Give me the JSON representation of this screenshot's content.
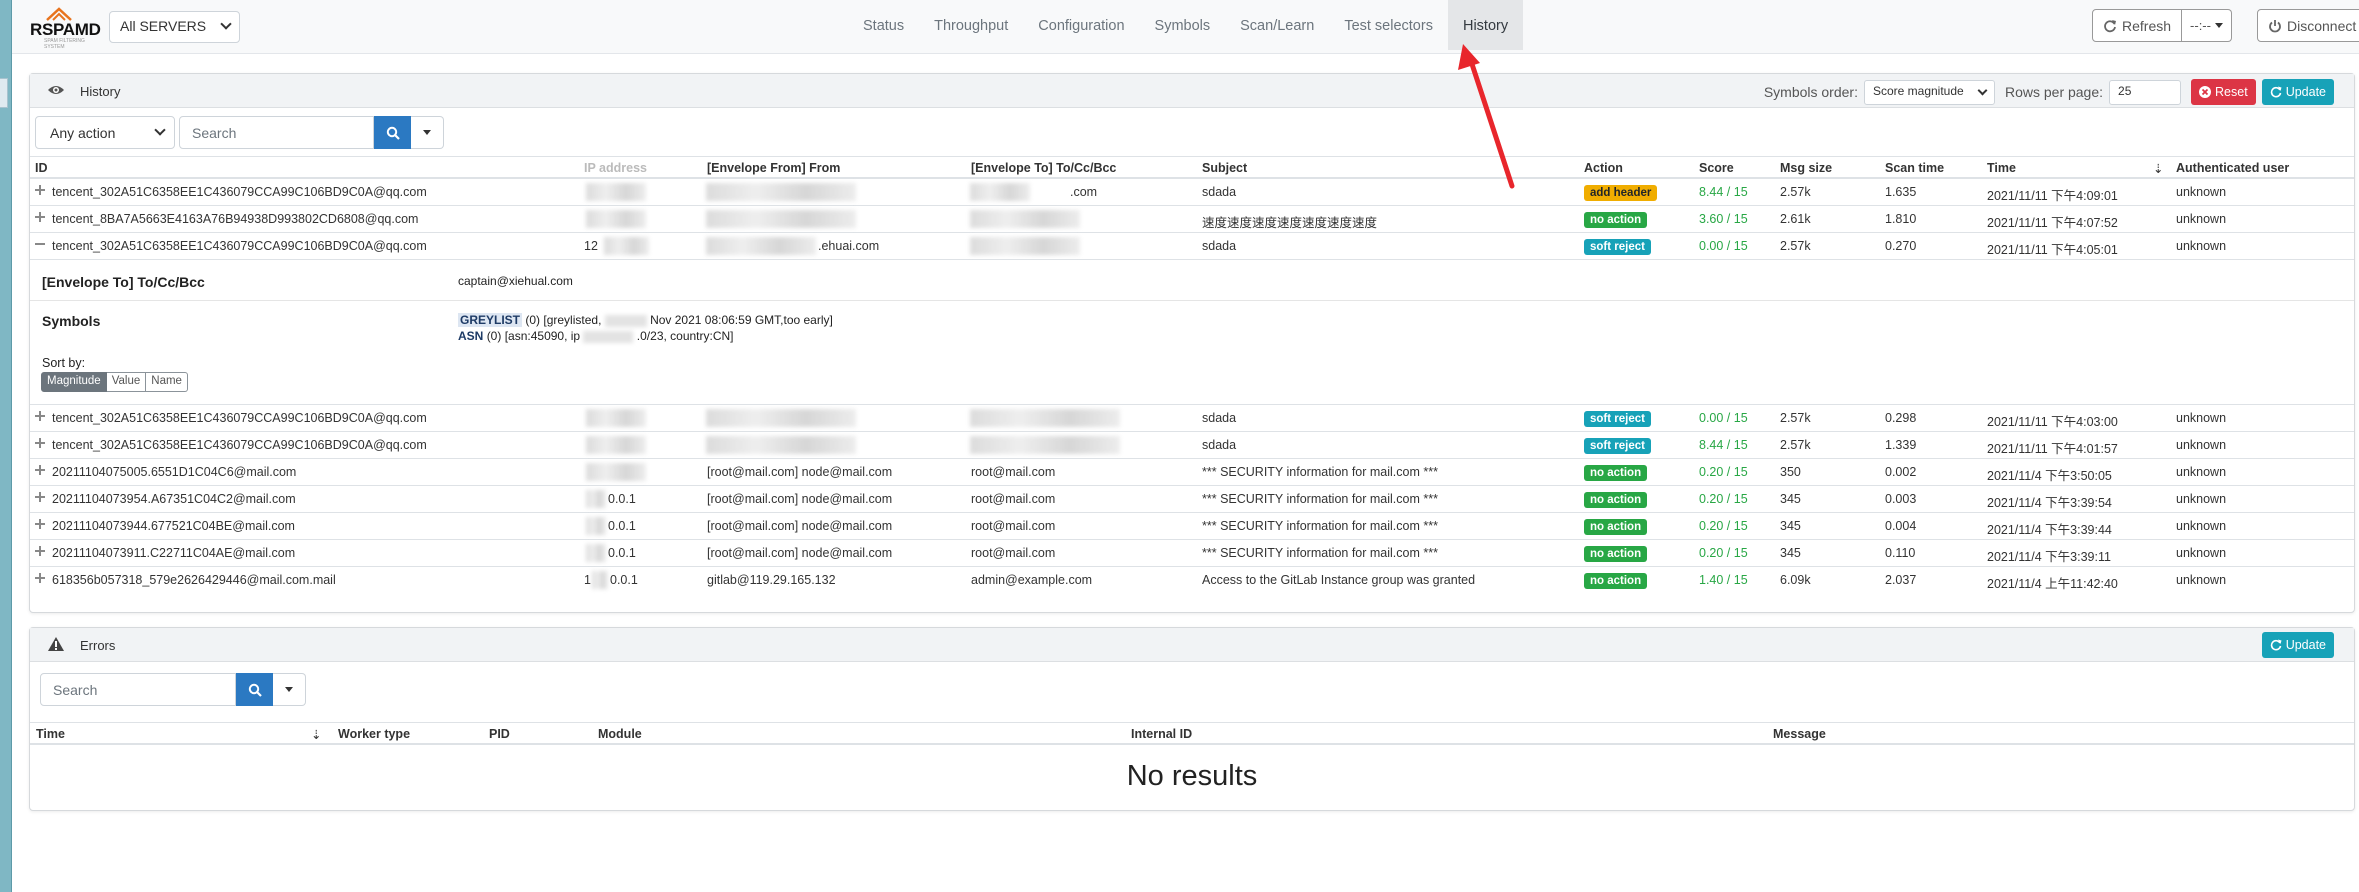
{
  "brand": {
    "logo_text": "RSPAMD",
    "logo_sub": "SPAM FILTERING SYSTEM"
  },
  "server_select": {
    "value": "All SERVERS"
  },
  "nav": {
    "items": [
      "Status",
      "Throughput",
      "Configuration",
      "Symbols",
      "Scan/Learn",
      "Test selectors",
      "History"
    ],
    "active": "History"
  },
  "header_buttons": {
    "refresh": "Refresh",
    "interval": "--:--",
    "disconnect": "Disconnect"
  },
  "history": {
    "title": "History",
    "symbols_order_label": "Symbols order:",
    "symbols_order_value": "Score magnitude",
    "rows_per_page_label": "Rows per page:",
    "rows_per_page": "25",
    "reset_label": "Reset",
    "update_label": "Update",
    "action_filter": "Any action",
    "search_placeholder": "Search",
    "columns": {
      "id": "ID",
      "ip": "IP address",
      "from": "[Envelope From] From",
      "to": "[Envelope To] To/Cc/Bcc",
      "subject": "Subject",
      "action": "Action",
      "score": "Score",
      "size": "Msg size",
      "scan_time": "Scan time",
      "time": "Time",
      "user": "Authenticated user"
    },
    "rows_top": [
      {
        "id": "tencent_302A51C6358EE1C436079CCA99C106BD9C0A@qq.com",
        "ip": "",
        "from": "",
        "to": ".com",
        "subject": "sdada",
        "action": "add header",
        "score": "8.44 / 15",
        "size": "2.57k",
        "scan_time": "1.635",
        "time": "2021/11/11 下午4:09:01",
        "user": "unknown"
      },
      {
        "id": "tencent_8BA7A5663E4163A76B94938D993802CD6808@qq.com",
        "ip": "",
        "from": "",
        "to": "",
        "subject": "速度速度速度速度速度速度速度",
        "action": "no action",
        "score": "3.60 / 15",
        "size": "2.61k",
        "scan_time": "1.810",
        "time": "2021/11/11 下午4:07:52",
        "user": "unknown"
      },
      {
        "id": "tencent_302A51C6358EE1C436079CCA99C106BD9C0A@qq.com",
        "ip": "12",
        "from": ".ehuai.com",
        "to": "",
        "subject": "sdada",
        "action": "soft reject",
        "score": "0.00 / 15",
        "size": "2.57k",
        "scan_time": "0.270",
        "time": "2021/11/11 下午4:05:01",
        "user": "unknown"
      }
    ],
    "detail": {
      "to_label": "[Envelope To] To/Cc/Bcc",
      "to_value": "captain@xiehual.com",
      "symbols_label": "Symbols",
      "sym1_name": "GREYLIST",
      "sym1_score": "(0)",
      "sym1_args": "[greylisted, ",
      "sym1_rest": "Nov 2021 08:06:59 GMT,too early]",
      "sym2_name": "ASN",
      "sym2_score": "(0)",
      "sym2_args": "[asn:45090, ip",
      "sym2_rest": ".0/23, country:CN]",
      "sort_label": "Sort by:",
      "sort_options": [
        "Magnitude",
        "Value",
        "Name"
      ]
    },
    "rows_bottom": [
      {
        "id": "tencent_302A51C6358EE1C436079CCA99C106BD9C0A@qq.com",
        "ip": "",
        "from": "",
        "to": "",
        "subject": "sdada",
        "action": "soft reject",
        "score": "0.00 / 15",
        "size": "2.57k",
        "scan_time": "0.298",
        "time": "2021/11/11 下午4:03:00",
        "user": "unknown"
      },
      {
        "id": "tencent_302A51C6358EE1C436079CCA99C106BD9C0A@qq.com",
        "ip": "",
        "from": "",
        "to": "",
        "subject": "sdada",
        "action": "soft reject",
        "score": "8.44 / 15",
        "size": "2.57k",
        "scan_time": "1.339",
        "time": "2021/11/11 下午4:01:57",
        "user": "unknown"
      },
      {
        "id": "20211104075005.6551D1C04C6@mail.com",
        "ip": "",
        "from": "[root@mail.com] node@mail.com",
        "to": "root@mail.com",
        "subject": "*** SECURITY information for mail.com ***",
        "action": "no action",
        "score": "0.20 / 15",
        "size": "350",
        "scan_time": "0.002",
        "time": "2021/11/4 下午3:50:05",
        "user": "unknown"
      },
      {
        "id": "20211104073954.A67351C04C2@mail.com",
        "ip": "0.0.1",
        "from": "[root@mail.com] node@mail.com",
        "to": "root@mail.com",
        "subject": "*** SECURITY information for mail.com ***",
        "action": "no action",
        "score": "0.20 / 15",
        "size": "345",
        "scan_time": "0.003",
        "time": "2021/11/4 下午3:39:54",
        "user": "unknown"
      },
      {
        "id": "20211104073944.677521C04BE@mail.com",
        "ip": "0.0.1",
        "from": "[root@mail.com] node@mail.com",
        "to": "root@mail.com",
        "subject": "*** SECURITY information for mail.com ***",
        "action": "no action",
        "score": "0.20 / 15",
        "size": "345",
        "scan_time": "0.004",
        "time": "2021/11/4 下午3:39:44",
        "user": "unknown"
      },
      {
        "id": "20211104073911.C22711C04AE@mail.com",
        "ip": "0.0.1",
        "from": "[root@mail.com] node@mail.com",
        "to": "root@mail.com",
        "subject": "*** SECURITY information for mail.com ***",
        "action": "no action",
        "score": "0.20 / 15",
        "size": "345",
        "scan_time": "0.110",
        "time": "2021/11/4 下午3:39:11",
        "user": "unknown"
      },
      {
        "id": "618356b057318_579e2626429446@mail.com.mail",
        "ip": "1",
        "ip2": "0.0.1",
        "from": "gitlab@119.29.165.132",
        "to": "admin@example.com",
        "subject": "Access to the GitLab Instance group was granted",
        "action": "no action",
        "score": "1.40 / 15",
        "size": "6.09k",
        "scan_time": "2.037",
        "time": "2021/11/4 上午11:42:40",
        "user": "unknown"
      }
    ]
  },
  "errors": {
    "title": "Errors",
    "update_label": "Update",
    "search_placeholder": "Search",
    "columns": {
      "time": "Time",
      "worker": "Worker type",
      "pid": "PID",
      "module": "Module",
      "internal_id": "Internal ID",
      "message": "Message"
    },
    "empty_text": "No results"
  },
  "colors": {
    "accent": "#17a2b8",
    "danger": "#dc3545",
    "primary": "#2b79c2",
    "success": "#28a745",
    "warning": "#f0ad00"
  }
}
